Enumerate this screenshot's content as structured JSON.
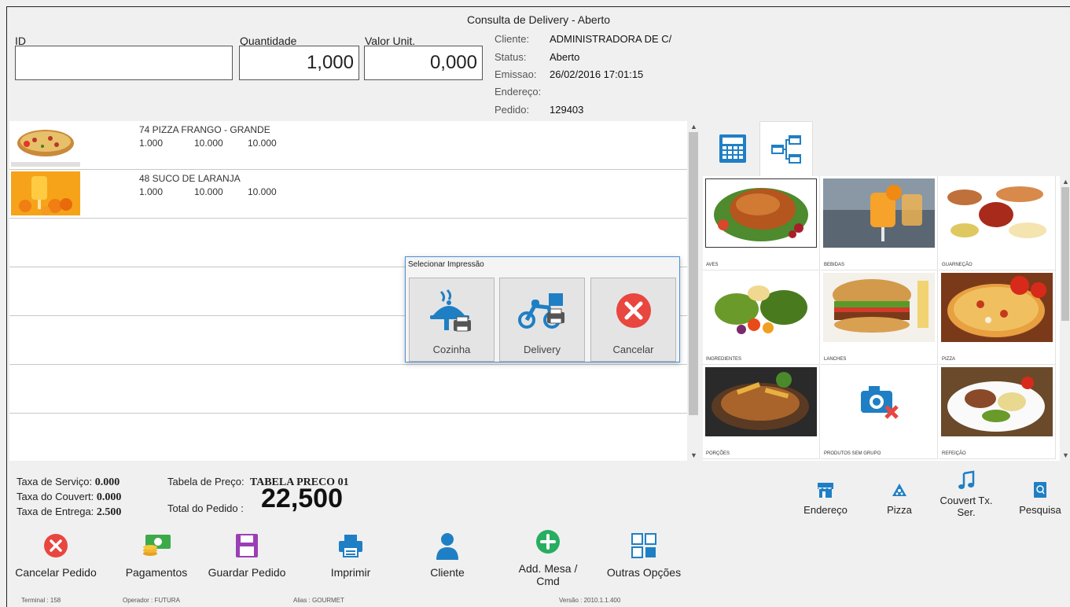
{
  "window": {
    "title": "Consulta de Delivery - Aberto"
  },
  "inputs": {
    "id_label": "ID",
    "id_value": "",
    "quantidade_label": "Quantidade",
    "quantidade_value": "1,000",
    "valor_label": "Valor Unit.",
    "valor_value": "0,000"
  },
  "info": {
    "cliente_label": "Cliente:",
    "cliente_value": "ADMINISTRADORA DE C/",
    "status_label": "Status:",
    "status_value": "Aberto",
    "emissao_label": "Emissao:",
    "emissao_value": "26/02/2016 17:01:15",
    "endereco_label": "Endereço:",
    "endereco_value": "",
    "pedido_label": "Pedido:",
    "pedido_value": "129403"
  },
  "items": [
    {
      "name": "74  PIZZA FRANGO - GRANDE",
      "qty": "1.000",
      "unit": "10.000",
      "total": "10.000",
      "image_icon": "pizza-photo"
    },
    {
      "name": "48  SUCO DE LARANJA",
      "qty": "1.000",
      "unit": "10.000",
      "total": "10.000",
      "image_icon": "orange-juice-photo"
    }
  ],
  "categories": [
    {
      "label": "AVES",
      "icon": "roast-chicken-photo"
    },
    {
      "label": "BEBIDAS",
      "icon": "juice-photo"
    },
    {
      "label": "GUARNEÇÃO",
      "icon": "side-dishes-photo"
    },
    {
      "label": "INGREDIENTES",
      "icon": "vegetables-photo"
    },
    {
      "label": "LANCHES",
      "icon": "burger-photo"
    },
    {
      "label": "PIZZA",
      "icon": "pizza-photo"
    },
    {
      "label": "PORÇÕES",
      "icon": "portions-photo"
    },
    {
      "label": "PRODUTOS SEM GRUPO",
      "icon": "no-image-camera-icon"
    },
    {
      "label": "REFEIÇÃO",
      "icon": "meal-photo"
    }
  ],
  "dialog": {
    "title": "Selecionar Impressão",
    "buttons": [
      {
        "label": "Cozinha",
        "icon": "cloche-printer-icon"
      },
      {
        "label": "Delivery",
        "icon": "motorbike-printer-icon"
      },
      {
        "label": "Cancelar",
        "icon": "cancel-x-icon"
      }
    ]
  },
  "totals": {
    "servico_label": "Taxa de Serviço:",
    "servico_value": "0.000",
    "couvert_label": "Taxa do Couvert:",
    "couvert_value": "0.000",
    "entrega_label": "Taxa de Entrega:",
    "entrega_value": "2.500",
    "tabela_label": "Tabela de Preço:",
    "tabela_value": "TABELA PRECO 01",
    "total_label": "Total do Pedido :",
    "total_value": "22,500"
  },
  "right_actions": [
    {
      "label": "Endereço",
      "icon": "store-icon"
    },
    {
      "label": "Pizza",
      "icon": "pizza-slice-icon"
    },
    {
      "label": "Couvert Tx. Ser.",
      "icon": "music-note-icon"
    },
    {
      "label": "Pesquisa",
      "icon": "search-book-icon"
    }
  ],
  "actions": [
    {
      "label": "Cancelar Pedido",
      "icon": "cancel-circle-icon"
    },
    {
      "label": "Pagamentos",
      "icon": "money-icon"
    },
    {
      "label": "Guardar Pedido",
      "icon": "save-disk-icon"
    },
    {
      "label": "Imprimir",
      "icon": "printer-icon"
    },
    {
      "label": "Cliente",
      "icon": "user-icon"
    },
    {
      "label": "Add. Mesa / Cmd",
      "icon": "add-circle-icon"
    },
    {
      "label": "Outras Opções",
      "icon": "grid-icon"
    }
  ],
  "status_bar": {
    "terminal": "Terminal :  158",
    "operador": "Operador :  FUTURA",
    "alias": "Alias :  GOURMET",
    "versao": "Versão :  2010.1.1.400"
  },
  "colors": {
    "accent_blue": "#1f7fc4",
    "cancel_red": "#e8463f",
    "add_green": "#27ae60",
    "save_purple": "#9b3fb5",
    "money_green": "#3daa4a"
  }
}
